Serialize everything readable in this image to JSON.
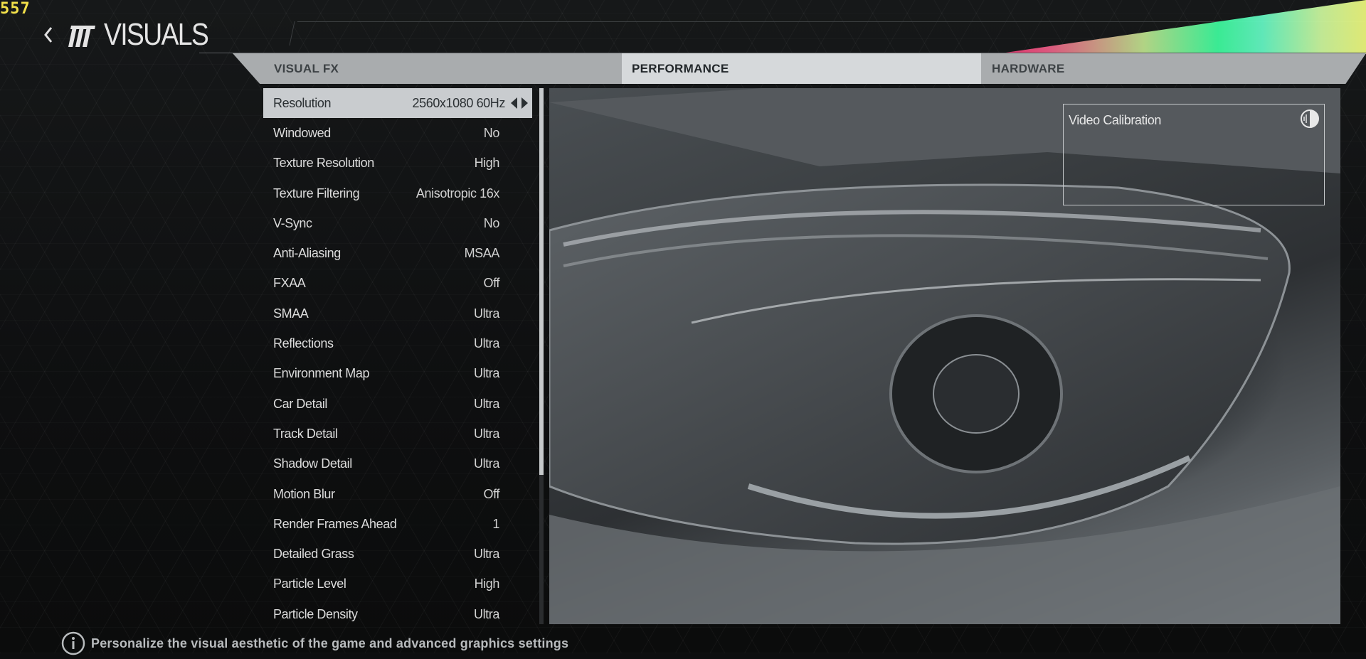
{
  "fps_counter": "557",
  "header": {
    "title": "VISUALS"
  },
  "tabs": [
    {
      "label": "VISUAL FX",
      "active": false
    },
    {
      "label": "PERFORMANCE",
      "active": true
    },
    {
      "label": "HARDWARE",
      "active": false
    }
  ],
  "settings": [
    {
      "label": "Resolution",
      "value": "2560x1080 60Hz",
      "selected": true
    },
    {
      "label": "Windowed",
      "value": "No"
    },
    {
      "label": "Texture Resolution",
      "value": "High"
    },
    {
      "label": "Texture Filtering",
      "value": "Anisotropic 16x"
    },
    {
      "label": "V-Sync",
      "value": "No"
    },
    {
      "label": "Anti-Aliasing",
      "value": "MSAA"
    },
    {
      "label": "FXAA",
      "value": "Off"
    },
    {
      "label": "SMAA",
      "value": "Ultra"
    },
    {
      "label": "Reflections",
      "value": "Ultra"
    },
    {
      "label": "Environment Map",
      "value": "Ultra"
    },
    {
      "label": "Car Detail",
      "value": "Ultra"
    },
    {
      "label": "Track Detail",
      "value": "Ultra"
    },
    {
      "label": "Shadow Detail",
      "value": "Ultra"
    },
    {
      "label": "Motion Blur",
      "value": "Off"
    },
    {
      "label": "Render Frames Ahead",
      "value": "1"
    },
    {
      "label": "Detailed Grass",
      "value": "Ultra"
    },
    {
      "label": "Particle Level",
      "value": "High"
    },
    {
      "label": "Particle Density",
      "value": "Ultra"
    }
  ],
  "preview": {
    "video_calibration_label": "Video Calibration",
    "calibration_icon": "contrast-icon"
  },
  "footer": {
    "icon": "info-icon",
    "text": "Personalize the visual aesthetic of the game and advanced graphics settings"
  },
  "colors": {
    "fps": "#f2e04a",
    "tab_bar": "#a9acae",
    "tab_active": "#d6d9db",
    "selected_row": "#c9cccf"
  }
}
